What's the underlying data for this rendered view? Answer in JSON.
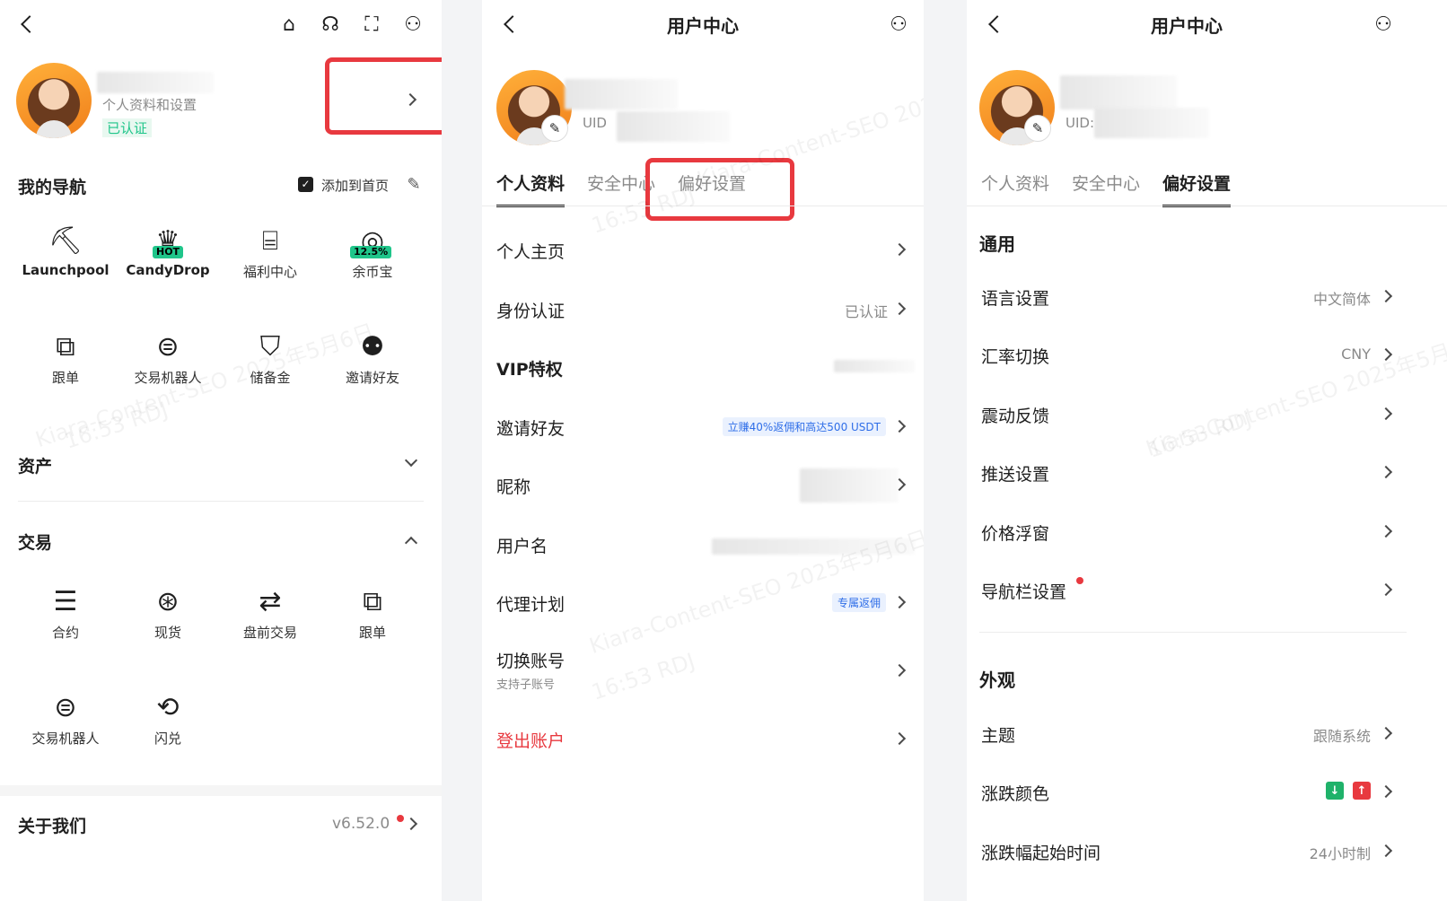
{
  "panel1": {
    "profile": {
      "subtitle": "个人资料和设置",
      "verified": "已认证"
    },
    "nav": {
      "title": "我的导航",
      "add_home": "添加到首页",
      "items": [
        {
          "label": "Launchpool",
          "icon": "pickaxe-icon"
        },
        {
          "label": "CandyDrop",
          "icon": "candy-icon",
          "badge": "HOT"
        },
        {
          "label": "福利中心",
          "icon": "gift-icon"
        },
        {
          "label": "余币宝",
          "icon": "earn-icon",
          "badge": "12.5%"
        },
        {
          "label": "跟单",
          "icon": "copy-trade-icon"
        },
        {
          "label": "交易机器人",
          "icon": "robot-icon"
        },
        {
          "label": "储备金",
          "icon": "shield-icon"
        },
        {
          "label": "邀请好友",
          "icon": "invite-icon"
        }
      ]
    },
    "assets": {
      "title": "资产"
    },
    "trade": {
      "title": "交易",
      "items": [
        {
          "label": "合约",
          "icon": "futures-icon"
        },
        {
          "label": "现货",
          "icon": "spot-icon"
        },
        {
          "label": "盘前交易",
          "icon": "premarket-icon"
        },
        {
          "label": "跟单",
          "icon": "copy-trade-icon"
        },
        {
          "label": "交易机器人",
          "icon": "robot-icon"
        },
        {
          "label": "闪兑",
          "icon": "swap-icon"
        }
      ]
    },
    "about": {
      "title": "关于我们",
      "version": "v6.52.0"
    }
  },
  "panel2": {
    "title": "用户中心",
    "uid_label": "UID",
    "tabs": [
      "个人资料",
      "安全中心",
      "偏好设置"
    ],
    "rows": [
      {
        "label": "个人主页",
        "value": ""
      },
      {
        "label": "身份认证",
        "value": "已认证"
      },
      {
        "label": "VIP特权",
        "value": ""
      },
      {
        "label": "邀请好友",
        "tag": "立赚40%返佣和高达500 USDT"
      },
      {
        "label": "昵称",
        "value": ""
      },
      {
        "label": "用户名",
        "value": ""
      },
      {
        "label": "代理计划",
        "tag": "专属返佣"
      },
      {
        "label": "切换账号",
        "sub": "支持子账号"
      },
      {
        "label": "登出账户"
      }
    ]
  },
  "panel3": {
    "title": "用户中心",
    "uid_label": "UID:",
    "tabs": [
      "个人资料",
      "安全中心",
      "偏好设置"
    ],
    "general": {
      "title": "通用",
      "rows": [
        {
          "label": "语言设置",
          "value": "中文简体"
        },
        {
          "label": "汇率切换",
          "value": "CNY"
        },
        {
          "label": "震动反馈",
          "value": ""
        },
        {
          "label": "推送设置",
          "value": ""
        },
        {
          "label": "价格浮窗",
          "value": ""
        },
        {
          "label": "导航栏设置",
          "value": ""
        }
      ]
    },
    "appearance": {
      "title": "外观",
      "rows": [
        {
          "label": "主题",
          "value": "跟随系统"
        },
        {
          "label": "涨跌颜色",
          "value": ""
        },
        {
          "label": "涨跌幅起始时间",
          "value": "24小时制"
        }
      ]
    }
  },
  "watermark": {
    "line1": "Kiara-Content-SEO 2025年5月6日",
    "line2": "16:53 RDJ"
  },
  "colors": {
    "accent_red": "#e8393f",
    "green": "#1fc58a",
    "blue": "#2f6ee8"
  }
}
